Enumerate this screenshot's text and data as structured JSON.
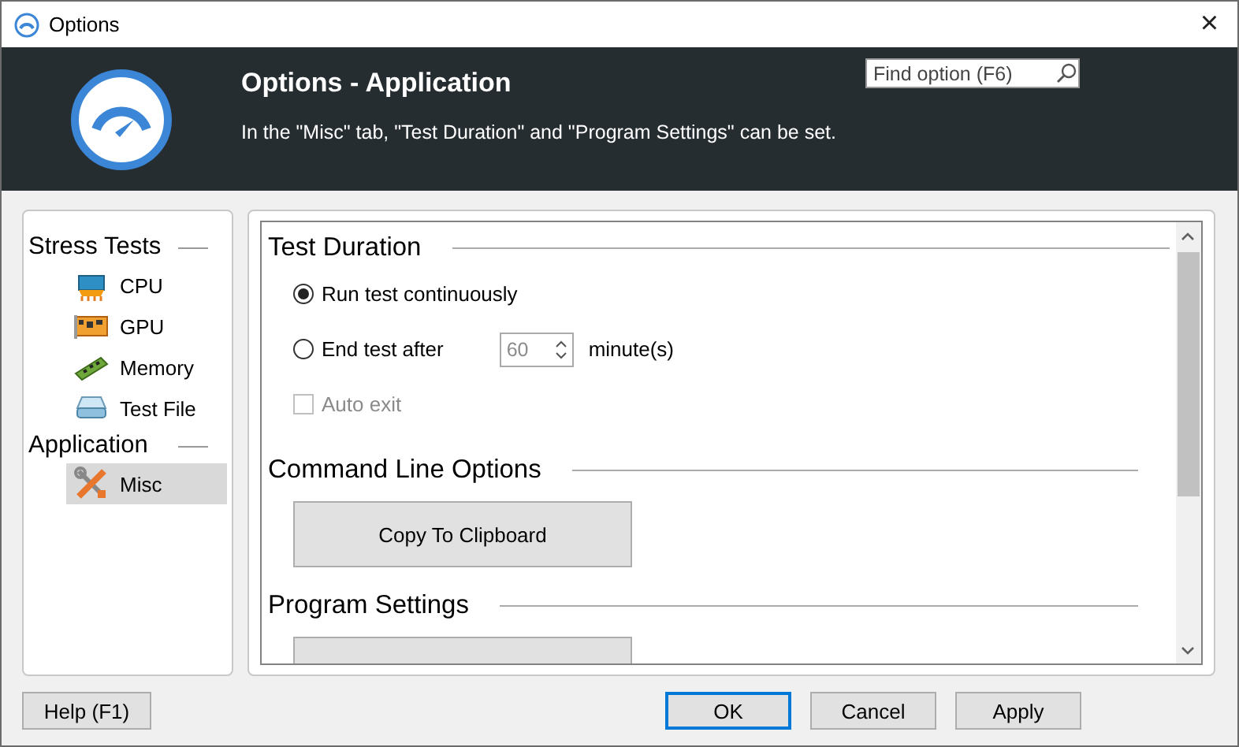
{
  "window": {
    "title": "Options",
    "close": "×"
  },
  "header": {
    "title": "Options - Application",
    "description": "In the \"Misc\" tab, \"Test Duration\" and \"Program Settings\" can be set.",
    "search": {
      "placeholder": "Find option (F6)"
    }
  },
  "sidebar": {
    "sections": [
      {
        "title": "Stress Tests",
        "items": [
          {
            "label": "CPU",
            "kind": "cpu",
            "selected": false
          },
          {
            "label": "GPU",
            "kind": "gpu",
            "selected": false
          },
          {
            "label": "Memory",
            "kind": "memory",
            "selected": false
          },
          {
            "label": "Test File",
            "kind": "disk",
            "selected": false
          }
        ]
      },
      {
        "title": "Application",
        "items": [
          {
            "label": "Misc",
            "kind": "tools",
            "selected": true
          }
        ]
      }
    ]
  },
  "content": {
    "sections": [
      {
        "title": "Test Duration",
        "items": [
          {
            "kind": "radio",
            "label": "Run test continuously",
            "selected": true
          },
          {
            "kind": "radio",
            "label": "End test after",
            "selected": false,
            "spin": {
              "value": "60",
              "disabled": true
            },
            "unit": "minute(s)"
          },
          {
            "kind": "checkbox",
            "label": "Auto exit",
            "checked": false,
            "disabled": true
          }
        ]
      },
      {
        "title": "Command Line Options",
        "items": [
          {
            "kind": "button",
            "label": "Copy To Clipboard"
          }
        ]
      },
      {
        "title": "Program Settings",
        "items": [
          {
            "kind": "cutbutton"
          }
        ]
      }
    ]
  },
  "footer": {
    "help": "Help (F1)",
    "buttons": [
      {
        "label": "OK",
        "default": true
      },
      {
        "label": "Cancel",
        "default": false
      },
      {
        "label": "Apply",
        "default": false
      }
    ]
  }
}
